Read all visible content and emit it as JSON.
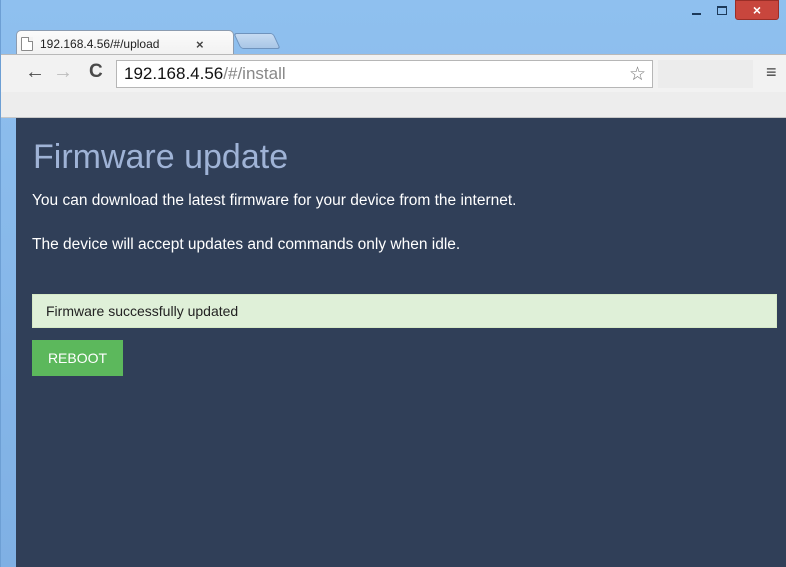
{
  "browser": {
    "tab_title": "192.168.4.56/#/upload",
    "tab_close": "×",
    "url_host": "192.168.4.56",
    "url_path": "/#/install",
    "window_min_icon": "minimize-icon",
    "window_max_icon": "maximize-icon",
    "window_close_label": "×"
  },
  "icons": {
    "back": "←",
    "forward": "→",
    "reload": "C",
    "star": "☆",
    "menu": "≡"
  },
  "page": {
    "title": "Firmware update",
    "paragraph1": "You can download the latest firmware for your device from the internet.",
    "paragraph2": "The device will accept updates and commands only when idle.",
    "alert": "Firmware successfully updated",
    "reboot_label": "REBOOT"
  },
  "colors": {
    "page_bg": "#303f58",
    "title": "#9fb3d6",
    "alert_bg": "#dff0d8",
    "button_bg": "#5cb85c",
    "close_btn": "#c8463d"
  }
}
